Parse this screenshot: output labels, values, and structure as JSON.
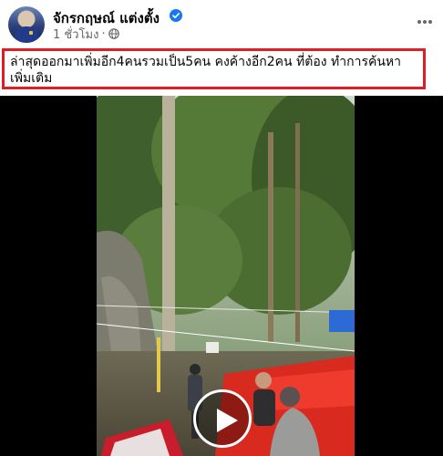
{
  "post": {
    "author": "จักรกฤษณ์ แต่งตั้ง",
    "time": "1 ชั่วโมง",
    "separator": "·",
    "caption": "ล่าสุดออกมาเพิ่มอีก4คนรวมเป็น5คน คงค้างอีก2คน ที่ต้อง ทำการค้นหาเพิ่มเติม",
    "icons": [
      "verified-badge-icon",
      "globe-icon",
      "more-options-icon",
      "play-icon"
    ]
  },
  "colors": {
    "verified": "#1877f2",
    "highlight_border": "#e31c23",
    "secondary_text": "#65676b",
    "video_background": "#000000"
  }
}
